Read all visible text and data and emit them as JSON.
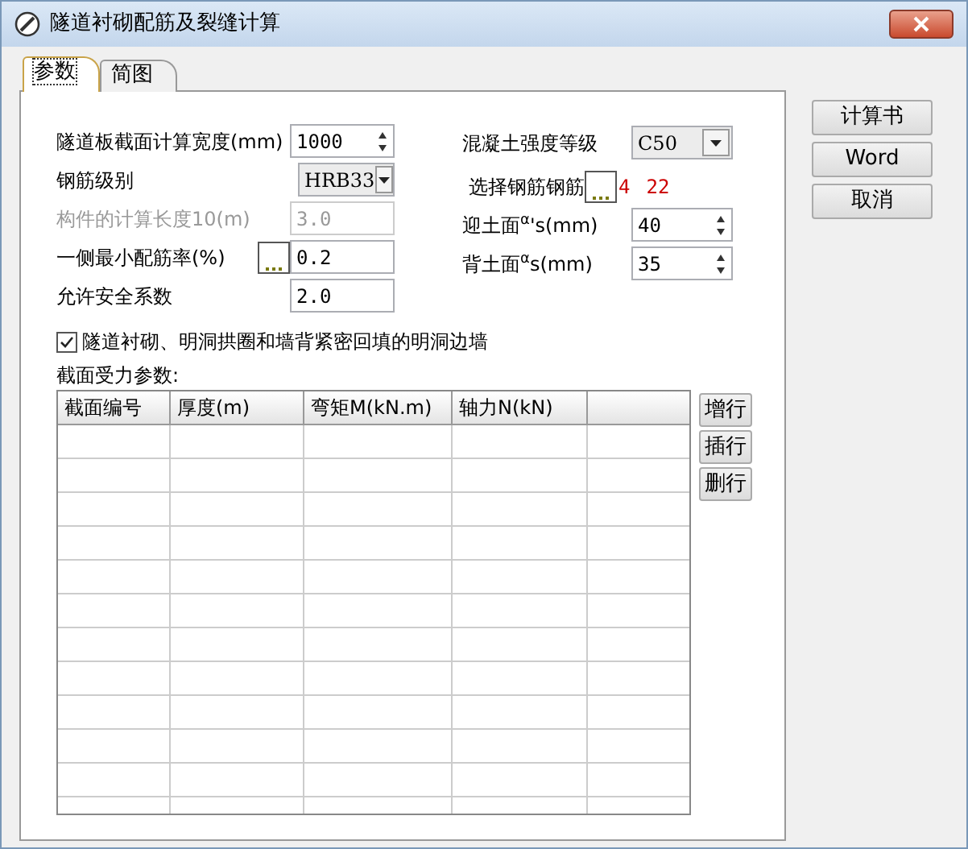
{
  "window": {
    "title": "隧道衬砌配筋及裂缝计算"
  },
  "tabs": [
    {
      "label": "参数",
      "selected": true
    },
    {
      "label": "简图",
      "selected": false
    }
  ],
  "left_fields": [
    {
      "kind": "spin",
      "label": "隧道板截面计算宽度(mm)",
      "value": "1000",
      "disabled": false
    },
    {
      "kind": "select",
      "label": "钢筋级别",
      "value": "HRB33",
      "disabled": false
    },
    {
      "kind": "text",
      "label": "构件的计算长度10(m)",
      "value": "3.0",
      "disabled": true
    },
    {
      "kind": "browse",
      "label": "一侧最小配筋率(%)",
      "value": "0.2",
      "disabled": false
    },
    {
      "kind": "text",
      "label": "允许安全系数",
      "value": "2.0",
      "disabled": false
    }
  ],
  "right_fields": [
    {
      "kind": "select",
      "label": "混凝土强度等级",
      "value": "C50"
    },
    {
      "kind": "browse",
      "label": "选择钢筋钢筋",
      "values": [
        "4",
        "22"
      ]
    },
    {
      "kind": "spin",
      "label": "迎土面$^{α}$'s(mm)",
      "value": "40"
    },
    {
      "kind": "spin",
      "label": "背土面$^{α}$s(mm)",
      "value": "35"
    }
  ],
  "checkbox": {
    "label": "隧道衬砌、明洞拱圈和墙背紧密回填的明洞边墙",
    "checked": true
  },
  "section_label": "截面受力参数:",
  "table": {
    "columns": [
      "截面编号",
      "厚度(m)",
      "弯矩M(kN.m)",
      "轴力N(kN)"
    ]
  },
  "row_buttons": [
    "增行",
    "插行",
    "删行"
  ],
  "side_buttons": [
    "计算书",
    "Word",
    "取消"
  ]
}
